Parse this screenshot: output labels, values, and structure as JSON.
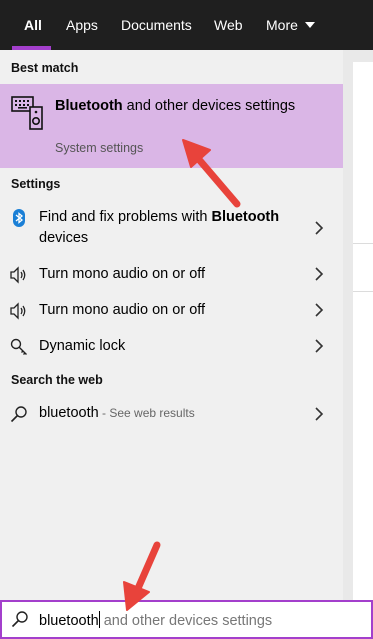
{
  "tabs": [
    {
      "label": "All"
    },
    {
      "label": "Apps"
    },
    {
      "label": "Documents"
    },
    {
      "label": "Web"
    },
    {
      "label": "More"
    }
  ],
  "sections": {
    "best_match": "Best match",
    "settings": "Settings",
    "search_web": "Search the web"
  },
  "best_match": {
    "title_bold": "Bluetooth",
    "title_rest": " and other devices settings",
    "subtitle": "System settings"
  },
  "settings_items": [
    {
      "text": "Find and fix problems with ",
      "bold": "Bluetooth",
      "text_after": " devices",
      "icon": "bluetooth-icon"
    },
    {
      "text": "Turn mono audio on or off",
      "icon": "speaker-icon"
    },
    {
      "text": "Turn mono audio on or off",
      "icon": "speaker-icon"
    },
    {
      "text": "Dynamic lock",
      "icon": "key-icon"
    }
  ],
  "web_result": {
    "query": "bluetooth",
    "suffix": " - See web results"
  },
  "search": {
    "typed": "bluetooth",
    "suggestion": " and other devices settings"
  },
  "colors": {
    "accent": "#a33fcc",
    "highlight": "#dab6e6",
    "topbar": "#1f1f1f",
    "annotation_arrow": "#e8433b"
  }
}
